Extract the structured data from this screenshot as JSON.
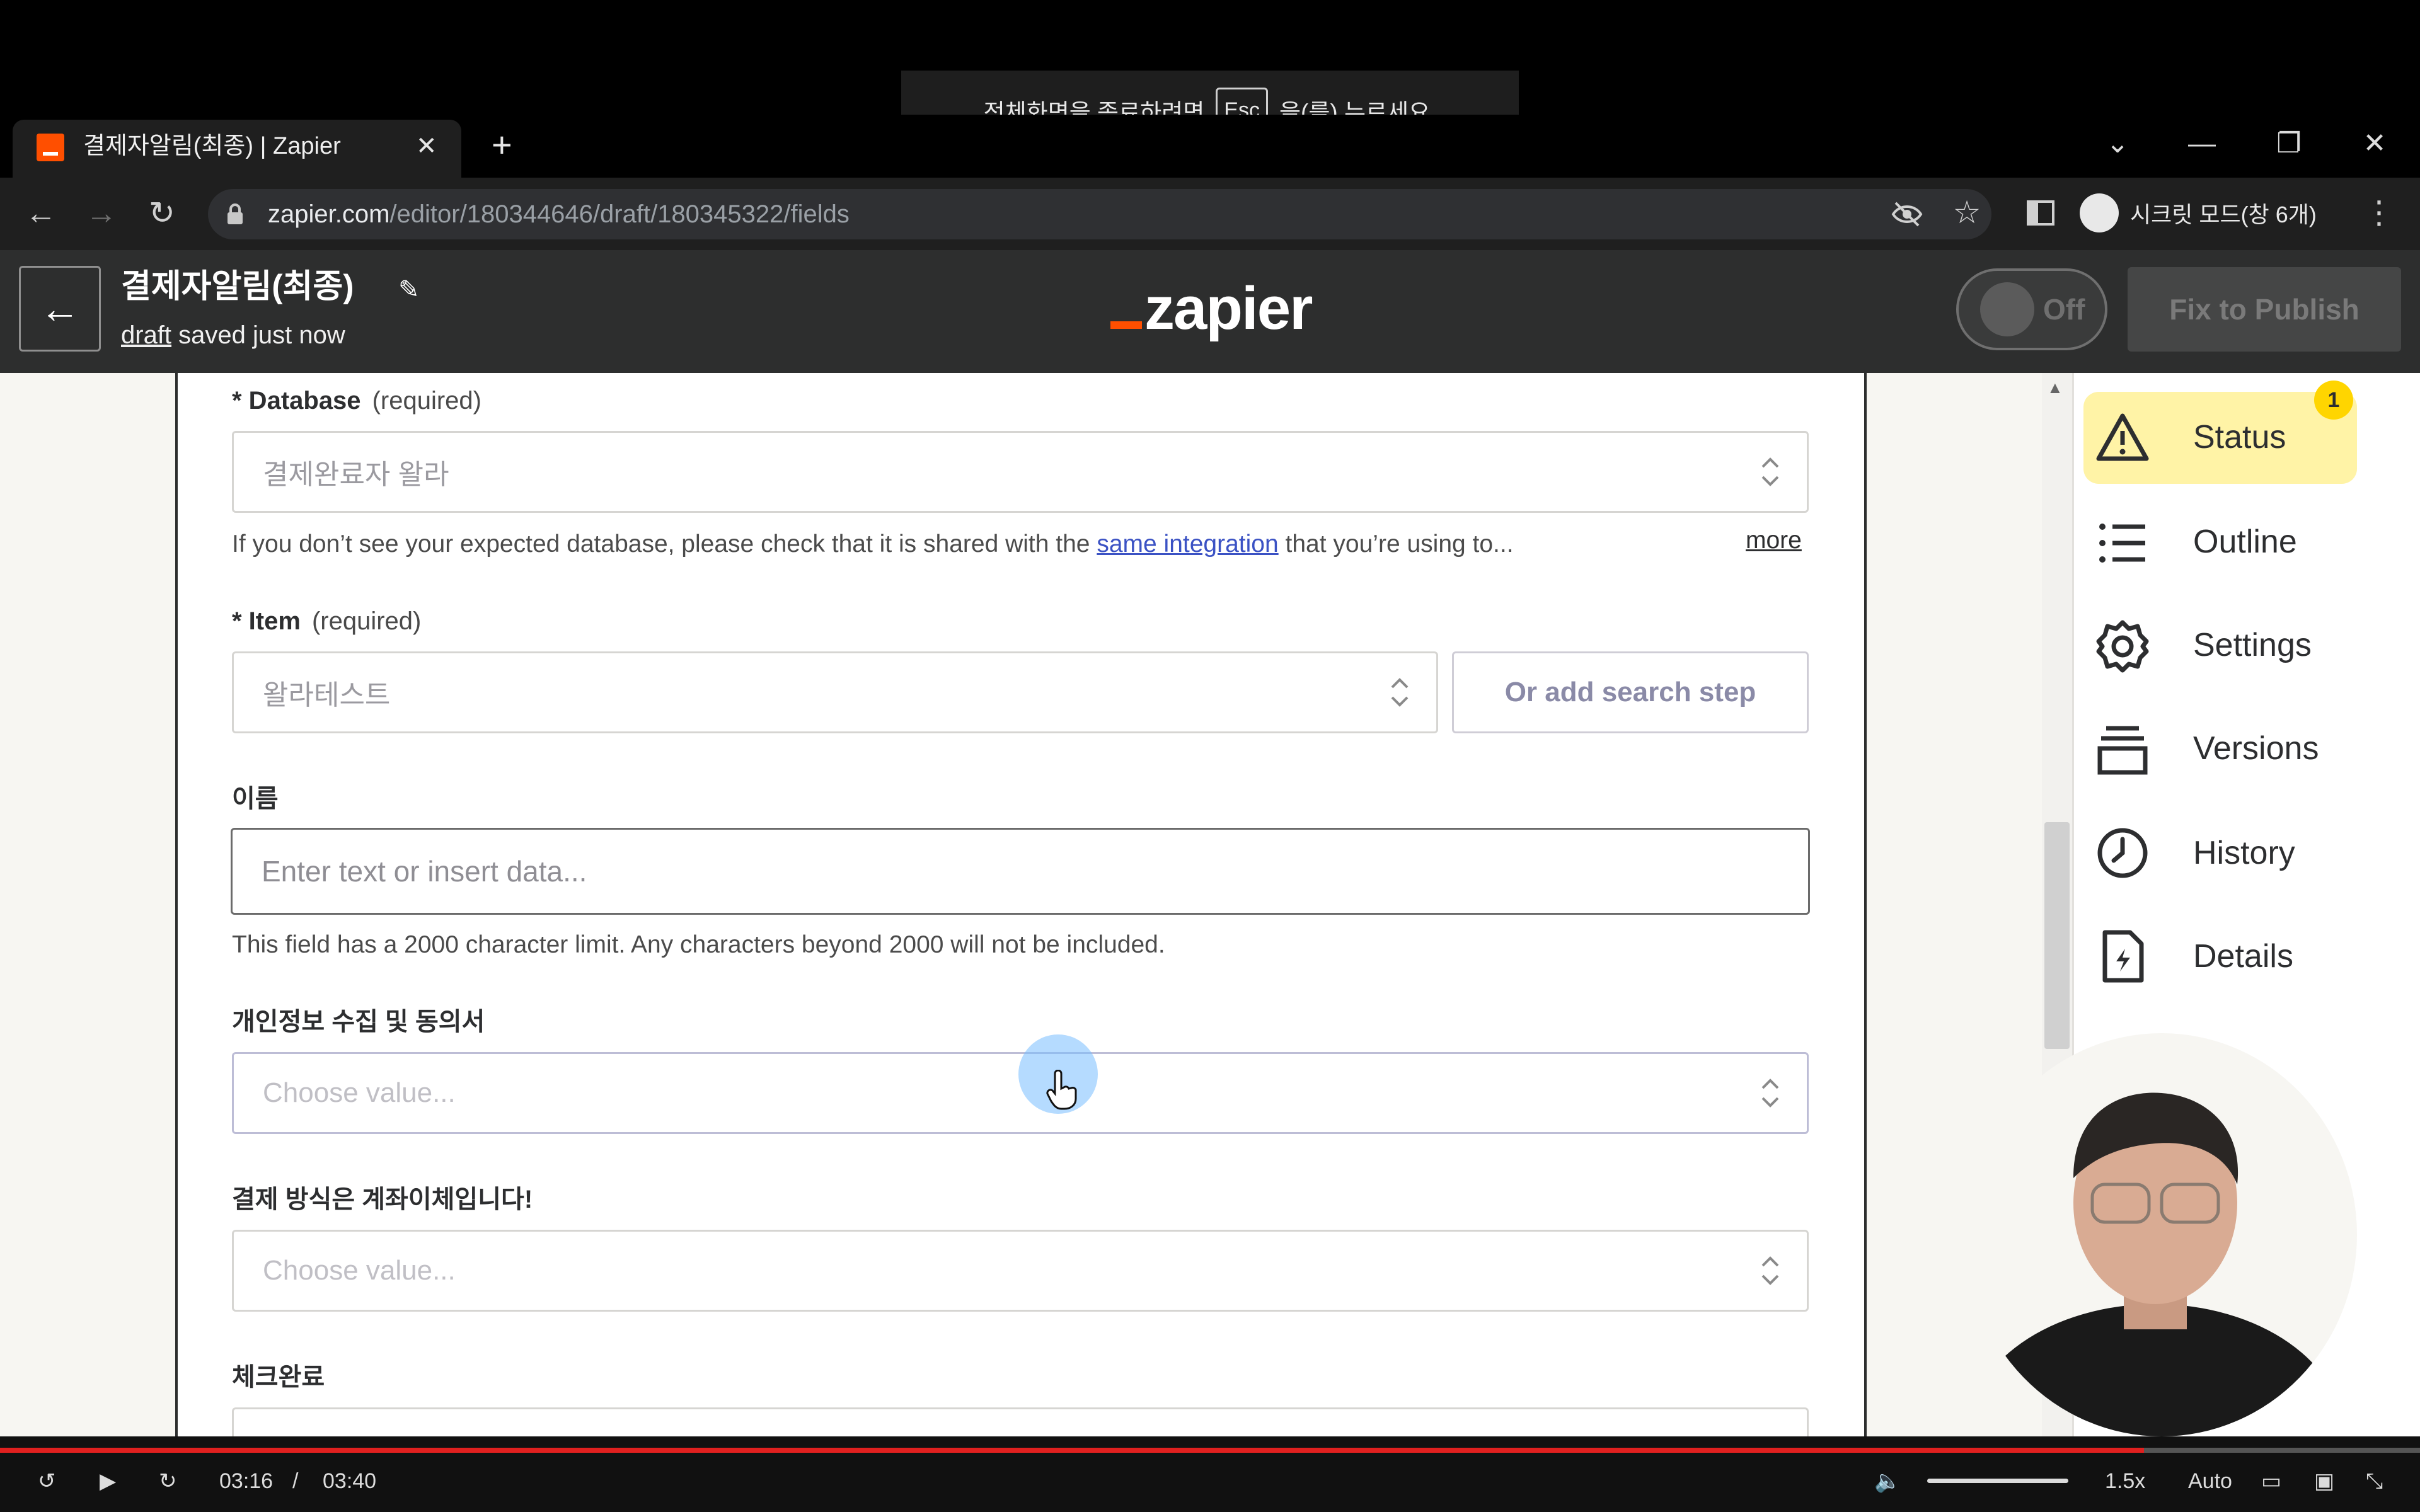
{
  "fullscreen_hint": {
    "prefix": "전체화면을 종료하려면",
    "key": "Esc",
    "suffix": "을(를) 누르세요."
  },
  "browser": {
    "tab_title": "결제자알림(최종) | Zapier",
    "tab_close": "✕",
    "new_tab": "+",
    "url_host": "zapier.com",
    "url_path": "/editor/180344646/draft/180345322/fields",
    "profile_label": "시크릿 모드(창 6개)",
    "colors": {
      "tab_favicon": "#ff4f00"
    }
  },
  "header": {
    "back_label": "←",
    "zap_title": "결제자알림(최종)",
    "draft_link": "draft",
    "draft_text": " saved just now",
    "logo_text": "zapier",
    "toggle_label": "Off",
    "toggle_state": "off",
    "publish_label": "Fix to Publish"
  },
  "form": {
    "database": {
      "label": "* Database",
      "required": "(required)",
      "value": "결제완료자 왈라",
      "help_prefix": "If you don’t see your expected database, please check that it is shared with the ",
      "help_link": "same integration",
      "help_suffix": " that you’re using to...",
      "more": "more"
    },
    "item": {
      "label": "* Item",
      "required": "(required)",
      "value": "왈라테스트",
      "search_step": "Or add search step"
    },
    "name_field": {
      "label": "이름",
      "placeholder": "Enter text or insert data...",
      "help": "This field has a 2000 character limit. Any characters beyond 2000 will not be included."
    },
    "privacy_field": {
      "label": "개인정보 수집 및 동의서",
      "placeholder": "Choose value..."
    },
    "payment_field": {
      "label": "결제 방식은 계좌이체입니다!",
      "placeholder": "Choose value..."
    },
    "check_field": {
      "label": "체크완료"
    }
  },
  "sidebar": {
    "items": [
      {
        "label": "Status",
        "icon": "warning-icon",
        "badge": "1"
      },
      {
        "label": "Outline",
        "icon": "list-icon"
      },
      {
        "label": "Settings",
        "icon": "gear-icon"
      },
      {
        "label": "Versions",
        "icon": "versions-icon"
      },
      {
        "label": "History",
        "icon": "clock-icon"
      },
      {
        "label": "Details",
        "icon": "file-bolt-icon"
      }
    ],
    "colors": {
      "status_highlight": "#fff3a6",
      "badge": "#ffd500"
    }
  },
  "video": {
    "current_time": "03:16",
    "separator": "/",
    "duration": "03:40",
    "progress_fraction": 0.886,
    "speed": "1.5x",
    "quality": "Auto",
    "colors": {
      "progress": "#e0201f"
    }
  }
}
